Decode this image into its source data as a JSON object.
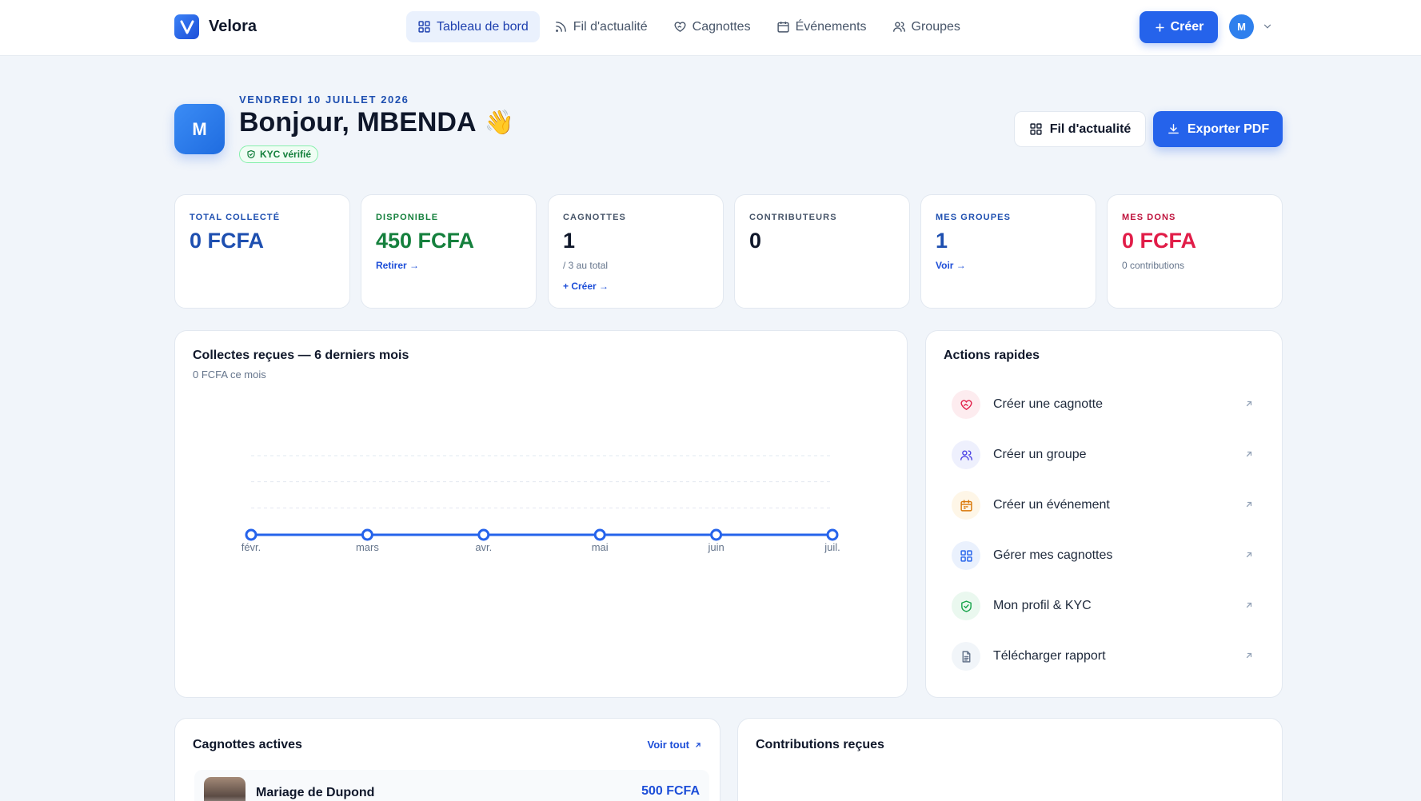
{
  "brand": {
    "name": "Velora",
    "logo_letter": "V"
  },
  "nav": {
    "items": [
      {
        "label": "Tableau de bord",
        "icon": "grid-icon",
        "active": true
      },
      {
        "label": "Fil d'actualité",
        "icon": "rss-icon",
        "active": false
      },
      {
        "label": "Cagnottes",
        "icon": "heart-hand-icon",
        "active": false
      },
      {
        "label": "Événements",
        "icon": "calendar-icon",
        "active": false
      },
      {
        "label": "Groupes",
        "icon": "users-icon",
        "active": false
      }
    ],
    "create_label": "Créer",
    "user_initial": "M"
  },
  "header": {
    "date": "VENDREDI 10 JUILLET 2026",
    "greeting": "Bonjour, MBENDA",
    "emoji": "👋",
    "avatar_initial": "M",
    "kyc_label": "KYC vérifié",
    "feed_button": "Fil d'actualité",
    "export_button": "Exporter PDF"
  },
  "stats": [
    {
      "label": "TOTAL COLLECTÉ",
      "value": "0 FCFA",
      "label_color": "#1e4fb0",
      "value_color": "#1e4fb0",
      "sub": "",
      "link": ""
    },
    {
      "label": "DISPONIBLE",
      "value": "450 FCFA",
      "label_color": "#15803d",
      "value_color": "#15803d",
      "sub": "",
      "link": "Retirer →"
    },
    {
      "label": "CAGNOTTES",
      "value": "1",
      "label_color": "#475569",
      "value_color": "#0f172a",
      "sub": "/ 3 au total",
      "link": "+ Créer →"
    },
    {
      "label": "CONTRIBUTEURS",
      "value": "0",
      "label_color": "#475569",
      "value_color": "#0f172a",
      "sub": "",
      "link": ""
    },
    {
      "label": "MES GROUPES",
      "value": "1",
      "label_color": "#1e4fb0",
      "value_color": "#1e4fb0",
      "sub": "",
      "link": "Voir →"
    },
    {
      "label": "MES DONS",
      "value": "0 FCFA",
      "label_color": "#be123c",
      "value_color": "#e11d48",
      "sub": "0 contributions",
      "link": ""
    }
  ],
  "chart_panel": {
    "title": "Collectes reçues — 6 derniers mois",
    "subtitle": "0 FCFA ce mois"
  },
  "chart_data": {
    "type": "line",
    "categories": [
      "févr.",
      "mars",
      "avr.",
      "mai",
      "juin",
      "juil."
    ],
    "series": [
      {
        "values": [
          0,
          0,
          0,
          0,
          0,
          0
        ]
      }
    ],
    "ylim": [
      0,
      1
    ],
    "grid": true,
    "color": "#2563eb"
  },
  "quick_actions": {
    "title": "Actions rapides",
    "items": [
      {
        "label": "Créer une cagnotte",
        "icon": "heart-hand-icon",
        "color": "#e11d48",
        "bg": "#fdecef"
      },
      {
        "label": "Créer un groupe",
        "icon": "users-icon",
        "color": "#4f46e5",
        "bg": "#eef0fd"
      },
      {
        "label": "Créer un événement",
        "icon": "calendar-icon",
        "color": "#d97706",
        "bg": "#fef6e7"
      },
      {
        "label": "Gérer mes cagnottes",
        "icon": "grid-icon",
        "color": "#2563eb",
        "bg": "#eaf1fd"
      },
      {
        "label": "Mon profil & KYC",
        "icon": "shield-check-icon",
        "color": "#16a34a",
        "bg": "#eaf8ef"
      },
      {
        "label": "Télécharger rapport",
        "icon": "file-icon",
        "color": "#64748b",
        "bg": "#f1f5f9"
      }
    ]
  },
  "active_cagnottes": {
    "title": "Cagnottes actives",
    "view_all": "Voir tout",
    "items": [
      {
        "name": "Mariage de Dupond",
        "amount": "500 FCFA"
      }
    ]
  },
  "contributions": {
    "title": "Contributions reçues"
  }
}
